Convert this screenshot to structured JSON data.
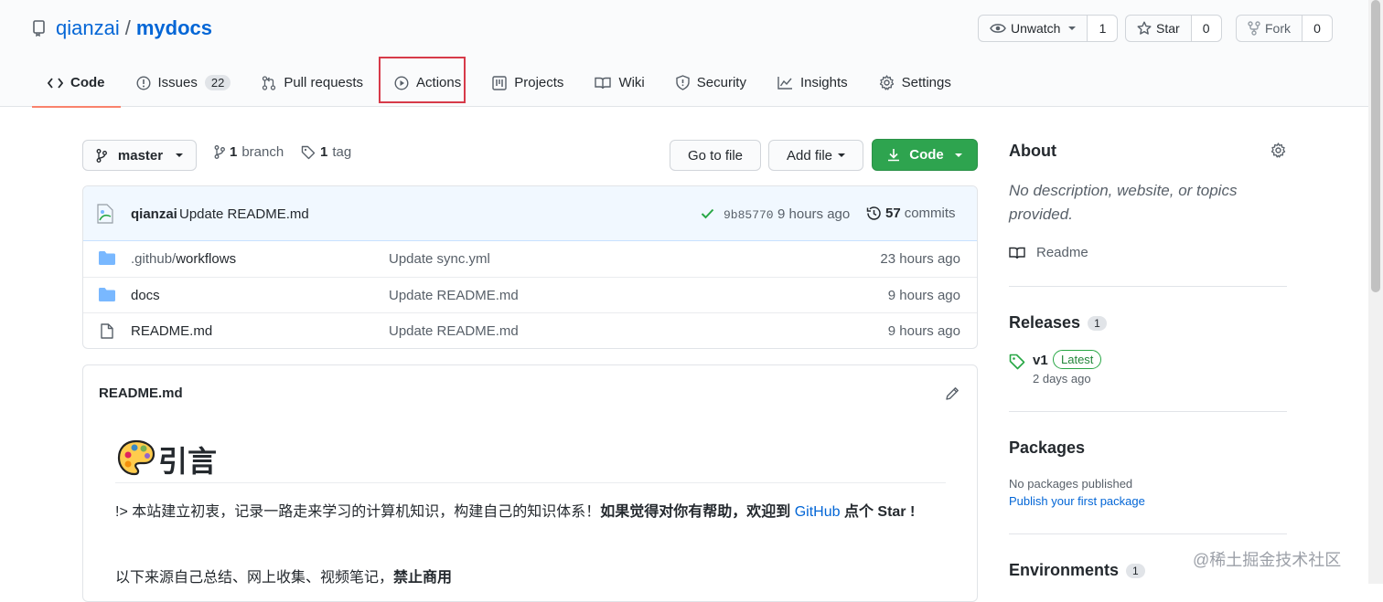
{
  "repo": {
    "owner": "qianzai",
    "separator": "/",
    "name": "mydocs"
  },
  "actions": {
    "watch": {
      "label": "Unwatch",
      "count": "1"
    },
    "star": {
      "label": "Star",
      "count": "0"
    },
    "fork": {
      "label": "Fork",
      "count": "0"
    }
  },
  "tabs": [
    {
      "label": "Code",
      "icon": "code-icon"
    },
    {
      "label": "Issues",
      "icon": "issue-icon",
      "count": "22"
    },
    {
      "label": "Pull requests",
      "icon": "pull-request-icon"
    },
    {
      "label": "Actions",
      "icon": "play-icon"
    },
    {
      "label": "Projects",
      "icon": "project-icon"
    },
    {
      "label": "Wiki",
      "icon": "book-icon"
    },
    {
      "label": "Security",
      "icon": "shield-icon"
    },
    {
      "label": "Insights",
      "icon": "graph-icon"
    },
    {
      "label": "Settings",
      "icon": "gear-icon"
    }
  ],
  "branchbar": {
    "branch": "master",
    "branch_count": "1",
    "branch_label": "branch",
    "tag_count": "1",
    "tag_label": "tag",
    "go_to_file": "Go to file",
    "add_file": "Add file",
    "code": "Code"
  },
  "commit": {
    "author": "qianzai",
    "message": "Update README.md",
    "sha": "9b85770",
    "time": "9 hours ago",
    "commit_count": "57",
    "commit_label": "commits"
  },
  "files": [
    {
      "type": "folder",
      "prefix": ".github/",
      "name": "workflows",
      "message": "Update sync.yml",
      "age": "23 hours ago"
    },
    {
      "type": "folder",
      "prefix": "",
      "name": "docs",
      "message": "Update README.md",
      "age": "9 hours ago"
    },
    {
      "type": "file",
      "prefix": "",
      "name": "README.md",
      "message": "Update README.md",
      "age": "9 hours ago"
    }
  ],
  "readme": {
    "filename": "README.md",
    "heading": "引言",
    "p1_lead": "!> 本站建立初衷，记录一路走来学习的计算机知识，构建自己的知识体系！",
    "p1_bold_a": "如果觉得对你有帮助，欢迎到 ",
    "p1_link": "GitHub",
    "p1_bold_b": " 点个 Star !",
    "p2_lead": "以下来源自己总结、网上收集、视频笔记，",
    "p2_bold": "禁止商用"
  },
  "about": {
    "title": "About",
    "description": "No description, website, or topics provided.",
    "readme_label": "Readme"
  },
  "releases": {
    "title": "Releases",
    "count": "1",
    "tag": "v1",
    "latest_label": "Latest",
    "date": "2 days ago"
  },
  "packages": {
    "title": "Packages",
    "none": "No packages published",
    "publish_link": "Publish your first package"
  },
  "environments": {
    "title": "Environments",
    "count": "1"
  },
  "watermark": "@稀土掘金技术社区",
  "colors": {
    "link": "#0366d6",
    "green": "#2ea44f",
    "highlight": "#d73a49",
    "tab_underline": "#f9826c"
  }
}
